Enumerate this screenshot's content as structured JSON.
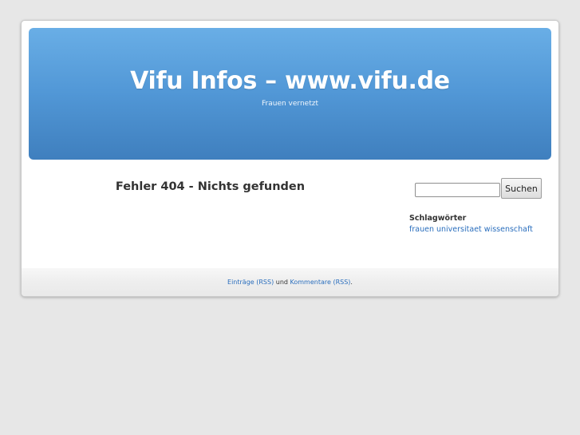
{
  "header": {
    "site_title": "Vifu Infos – www.vifu.de",
    "site_description": "Frauen vernetzt"
  },
  "content": {
    "error_title": "Fehler 404 - Nichts gefunden"
  },
  "sidebar": {
    "search": {
      "value": "",
      "button_label": "Suchen"
    },
    "tags": {
      "heading": "Schlagwörter",
      "items": [
        "frauen",
        "universitaet",
        "wissenschaft"
      ]
    }
  },
  "footer": {
    "entries_link": "Einträge (RSS)",
    "conjunction": " und ",
    "comments_link": "Kommentare (RSS)",
    "end": "."
  },
  "colors": {
    "header_gradient_top": "#69aee6",
    "header_gradient_bottom": "#3f7fbe",
    "link": "#2a6ebd",
    "page_background": "#e7e7e7"
  }
}
